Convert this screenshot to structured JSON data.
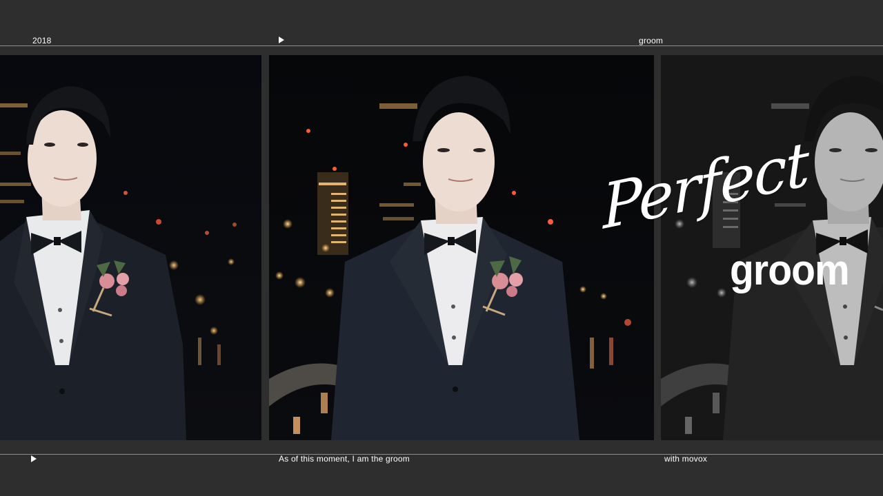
{
  "header": {
    "year": "2018",
    "play_icon": "play-triangle-icon",
    "label": "groom"
  },
  "panels": [
    {
      "name": "photo-panel-left",
      "style": "color"
    },
    {
      "name": "photo-panel-center",
      "style": "color"
    },
    {
      "name": "photo-panel-right",
      "style": "monochrome"
    }
  ],
  "overlay": {
    "script_word": "Perfect",
    "bold_word": "groom"
  },
  "footer": {
    "play_icon": "play-triangle-icon",
    "caption": "As of this moment, I am the groom",
    "credit": "with movox"
  },
  "colors": {
    "background": "#2e2e2e",
    "divider": "#8e8e8e",
    "text": "#ffffff"
  }
}
